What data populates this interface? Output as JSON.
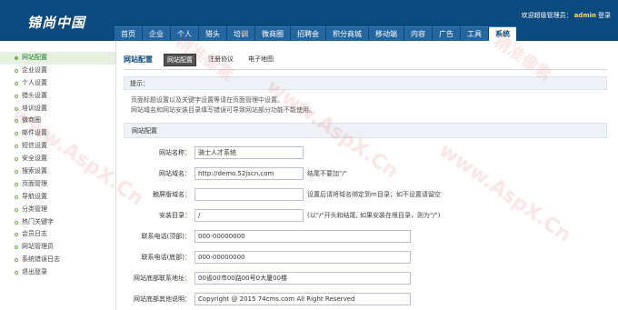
{
  "header": {
    "logo": "锦尚中国",
    "welcome_prefix": "欢迎超级管理员：",
    "username": "admin",
    "logout": "登录"
  },
  "nav": [
    "首页",
    "企业",
    "个人",
    "猎头",
    "培训",
    "微商圈",
    "招聘会",
    "积分商城",
    "移动端",
    "内容",
    "广告",
    "工具",
    "系统"
  ],
  "nav_active_index": 12,
  "sidebar": {
    "active_index": 0,
    "items": [
      "网站配置",
      "企业设置",
      "个人设置",
      "猎头设置",
      "培训设置",
      "微商圈",
      "邮件设置",
      "短信设置",
      "安全设置",
      "搜索设置",
      "页面管理",
      "导航设置",
      "分类管理",
      "热门关键字",
      "会员日志",
      "网站管理员",
      "系统错误日志",
      "退出登录"
    ]
  },
  "subnav": {
    "title": "网站配置",
    "tabs": [
      "网站配置",
      "注册协议",
      "电子地图"
    ],
    "active_index": 0
  },
  "tips": {
    "heading": "提示：",
    "lines": [
      "页面标题设置以及关键字设置等请在页面管理中设置。",
      "网站域名和网站安装目录填写错误可导致网站部分功能不能使用。"
    ]
  },
  "section": {
    "heading": "网站配置"
  },
  "form": {
    "site_name": {
      "label": "网站名称：",
      "value": "骑士人才系统",
      "hint": ""
    },
    "site_domain": {
      "label": "网站域名：",
      "value": "http://demo.52jscn.com",
      "hint": "结尾不要加\"/\""
    },
    "mobile_domain": {
      "label": "触屏版域名：",
      "value": "",
      "hint": "设置后请将域名绑定到m目录；如不设置请留空"
    },
    "install_dir": {
      "label": "安装目录：",
      "value": "/",
      "hint": "(以\"/\"开头和结尾, 如果安装在根目录，则为\"/\")"
    },
    "phone_top": {
      "label": "联系电话(顶部)：",
      "value": "000-00000000",
      "hint": ""
    },
    "phone_bottom": {
      "label": "联系电话(底部)：",
      "value": "000-00000000",
      "hint": ""
    },
    "footer_address": {
      "label": "网站底部联系地址：",
      "value": "00省00市00路00号0大厦00楼",
      "hint": ""
    },
    "footer_other": {
      "label": "网站底部其他说明：",
      "value": "Copyright @ 2015 74cms.com All Right Reserved",
      "hint": ""
    }
  },
  "watermark": "www.AspX.Cn",
  "watermark_cn": "精准像素"
}
